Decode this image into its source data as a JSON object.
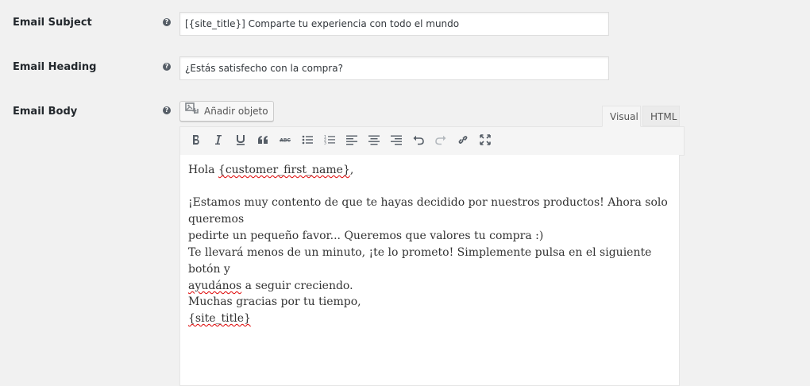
{
  "fields": {
    "subject": {
      "label": "Email Subject",
      "value": "[{site_title}] Comparte tu experiencia con todo el mundo"
    },
    "heading": {
      "label": "Email Heading",
      "value": "¿Estás satisfecho con la compra?"
    },
    "body": {
      "label": "Email Body"
    }
  },
  "help_glyph": "?",
  "media_button": {
    "label": "Añadir objeto",
    "icon": "add-media-icon"
  },
  "tabs": {
    "visual": "Visual",
    "html": "HTML",
    "active": "visual"
  },
  "toolbar": [
    {
      "name": "bold",
      "icon": "bold-icon"
    },
    {
      "name": "italic",
      "icon": "italic-icon"
    },
    {
      "name": "underline",
      "icon": "underline-icon"
    },
    {
      "name": "blockquote",
      "icon": "quote-icon"
    },
    {
      "name": "strikethrough",
      "icon": "strikethrough-icon"
    },
    {
      "name": "bullet-list",
      "icon": "bullet-list-icon"
    },
    {
      "name": "numbered-list",
      "icon": "numbered-list-icon"
    },
    {
      "name": "align-left",
      "icon": "align-left-icon"
    },
    {
      "name": "align-center",
      "icon": "align-center-icon"
    },
    {
      "name": "align-right",
      "icon": "align-right-icon"
    },
    {
      "name": "undo",
      "icon": "undo-icon"
    },
    {
      "name": "redo",
      "icon": "redo-icon",
      "disabled": true
    },
    {
      "name": "link",
      "icon": "link-icon"
    },
    {
      "name": "fullscreen",
      "icon": "fullscreen-icon"
    }
  ],
  "editor": {
    "greeting_prefix": "Hola ",
    "greeting_token": "{customer_first_name}",
    "greeting_suffix": ",",
    "p2_line1": "¡Estamos muy contento de que te hayas decidido por nuestros productos! Ahora solo queremos",
    "p2_line2": "pedirte un pequeño favor... Queremos que valores tu compra :)",
    "p3_line1": "Te llevará menos de un minuto, ¡te lo prometo! Simplemente pulsa en el siguiente botón y",
    "p3_line2_word": "ayudános",
    "p3_line2_rest": " a seguir creciendo.",
    "p4_line1": "Muchas gracias por tu tiempo,",
    "p4_token": "{site_title}"
  }
}
